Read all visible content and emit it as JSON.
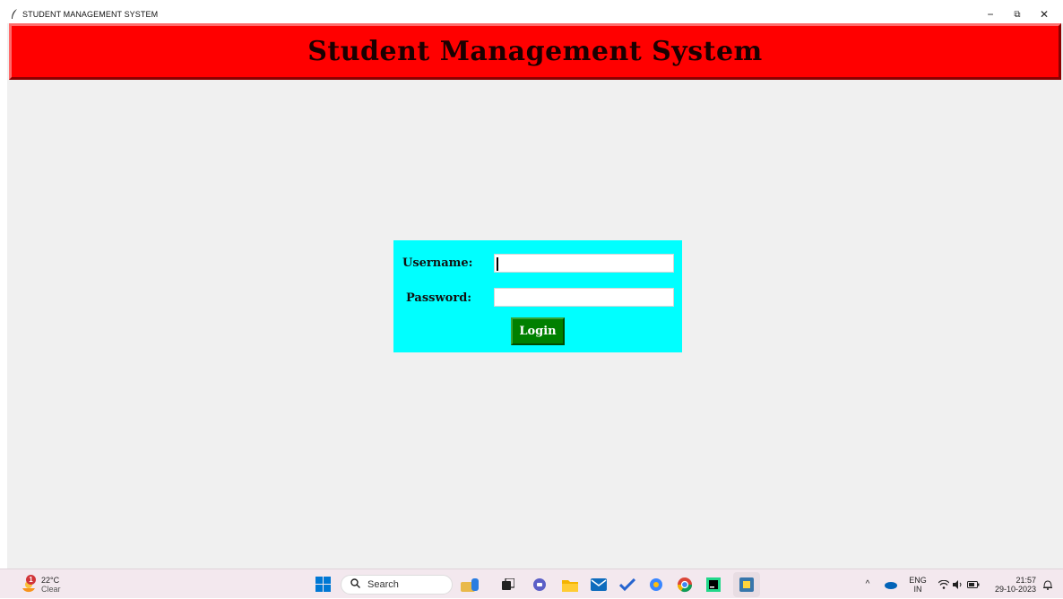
{
  "window": {
    "title": "STUDENT MANAGEMENT SYSTEM",
    "controls": {
      "minimize": "−",
      "restore": "⧉",
      "close": "✕"
    }
  },
  "banner": {
    "heading": "Student Management System"
  },
  "login": {
    "username_label": "Username:",
    "username_value": "",
    "password_label": "Password:",
    "password_value": "",
    "login_button": "Login"
  },
  "taskbar": {
    "weather": {
      "temperature": "22°C",
      "condition": "Clear",
      "badge": "1"
    },
    "search_placeholder": "Search",
    "tray": {
      "language_top": "ENG",
      "language_bottom": "IN",
      "time": "21:57",
      "date": "29-10-2023"
    }
  },
  "colors": {
    "banner_bg": "#ff0000",
    "login_box_bg": "#00ffff",
    "login_button_bg": "#008000",
    "window_bg": "#f0f0f0"
  },
  "icons": [
    "feather-icon",
    "weather-icon",
    "windows-start-icon",
    "search-icon",
    "widgets-icon",
    "task-view-icon",
    "chat-icon",
    "file-explorer-icon",
    "mail-icon",
    "todo-icon",
    "copilot-icon",
    "chrome-icon",
    "pycharm-icon",
    "python-idle-icon",
    "chevron-up-icon",
    "onedrive-icon",
    "wifi-icon",
    "volume-icon",
    "battery-icon",
    "notification-bell-icon"
  ]
}
